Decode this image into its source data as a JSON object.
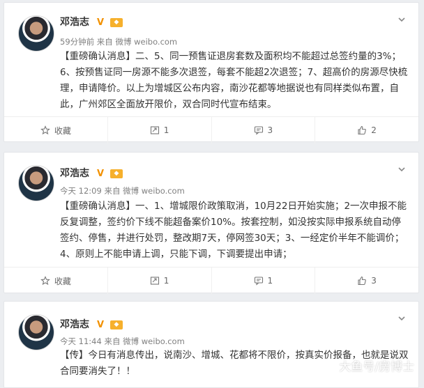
{
  "posts": [
    {
      "author": "邓浩志",
      "verified": "V",
      "meta": "59分钟前 来自 微博 weibo.com",
      "text": "【重磅确认消息】二、5、同一预售证退房套数及面积均不能超过总签约量的3%；6、按预售证同一房源不能多次退签，每套不能超2次退签；7、超高价的房源尽快梳理，申请降价。以上为增城区公布内容，南沙花都等地据说也有同样类似布置，自此，广州郊区全面放开限价，双合同时代宣布结束。",
      "actions": {
        "favorite": "收藏",
        "repost": "1",
        "comment": "3",
        "like": "2"
      }
    },
    {
      "author": "邓浩志",
      "verified": "V",
      "meta": "今天 12:09 来自 微博 weibo.com",
      "text": "【重磅确认消息】一、1、增城限价政策取消，10月22日开始实施；2一次申报不能反复调整，签约价下线不能超备案价10%。按套控制，如没按实际申报系统自动停签约、停售，并进行处罚，整改期7天，停网签30天；3、一经定价半年不能调价；4、原则上不能申请上调，只能下调，下调要提出申请；",
      "actions": {
        "favorite": "收藏",
        "repost": "1",
        "comment": "1",
        "like": "3"
      }
    },
    {
      "author": "邓浩志",
      "verified": "V",
      "meta": "今天 11:44 来自 微博 weibo.com",
      "text": "【传】今日有消息传出，说南沙、增城、花都将不限价，按真实价报备，也就是说双合同要消失了！！"
    }
  ],
  "watermark": "大鱼号/房博士",
  "colors": {
    "verified": "#f29100",
    "level": "#f6b02c",
    "text": "#333333",
    "meta": "#808080"
  }
}
